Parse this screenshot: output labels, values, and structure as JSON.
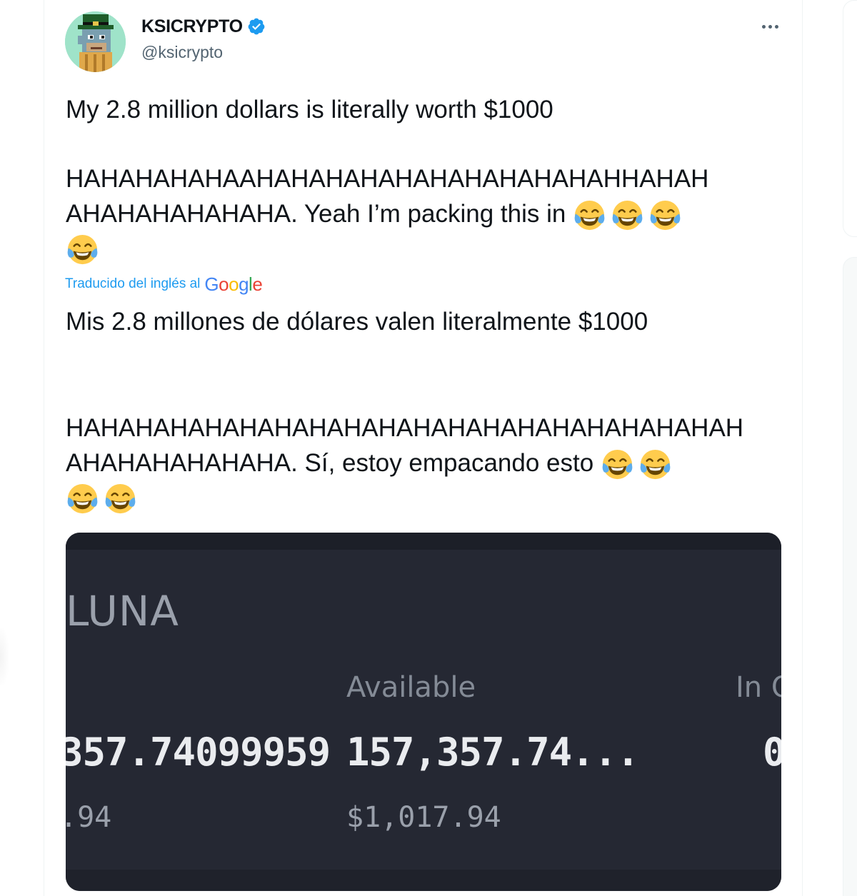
{
  "user": {
    "display_name": "KSICRYPTO",
    "handle": "@ksicrypto",
    "verified": true
  },
  "tweet": {
    "line1": "My 2.8 million dollars is literally worth $1000",
    "line2": "HAHAHAHAHAAHAHAHAHAHAHAHAHAHAHAHHAHAH",
    "line3": "AHAHAHAHAHAHA. Yeah I’m packing this in",
    "emoji_name": "face-with-tears-of-joy"
  },
  "translation": {
    "label": "Traducido del inglés al",
    "provider": "Google",
    "line1": "Mis 2.8 millones de dólares valen literalmente $1000",
    "line2": "HAHAHAHAHAHAHAHAHAHAHAHAHAHAHAHAHAHAHAH",
    "line3": "AHAHAHAHAHAHA. Sí, estoy empacando esto"
  },
  "media": {
    "asset": "LUNA",
    "available_label": "Available",
    "in_order_label": "In O",
    "total_value": "357.74099959",
    "available_value": "157,357.74...",
    "in_order_value": "0",
    "total_usd": ".94",
    "available_usd": "$1,017.94",
    "colors": {
      "card_bg": "#252833",
      "primary_text": "#eaecef",
      "secondary_text": "#848b96"
    }
  },
  "colors": {
    "link": "#1d9bf0",
    "verified": "#1d9bf0",
    "text": "#0f1419",
    "muted": "#536471"
  }
}
